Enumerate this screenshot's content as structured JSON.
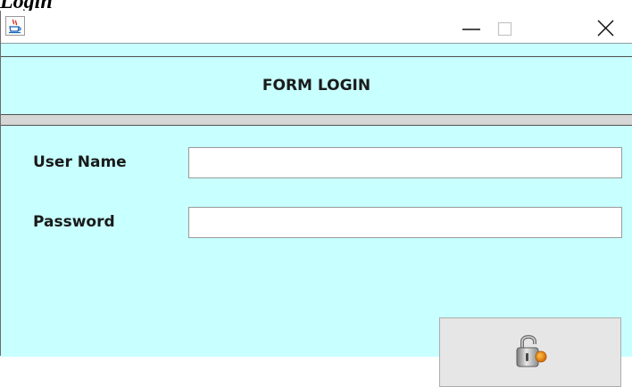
{
  "caption": "Login",
  "window": {
    "minimize_icon": "minimize-icon",
    "maximize_icon": "maximize-icon",
    "close_icon": "close-icon",
    "app_icon": "java-cup-icon"
  },
  "header": {
    "title": "FORM LOGIN"
  },
  "form": {
    "username_label": "User Name",
    "username_value": "",
    "password_label": "Password",
    "password_value": "",
    "login_button_icon": "padlock-icon"
  },
  "colors": {
    "panel_background": "#c8ffff",
    "separator": "#d6d6d6",
    "button_background": "#e6e6e6"
  }
}
